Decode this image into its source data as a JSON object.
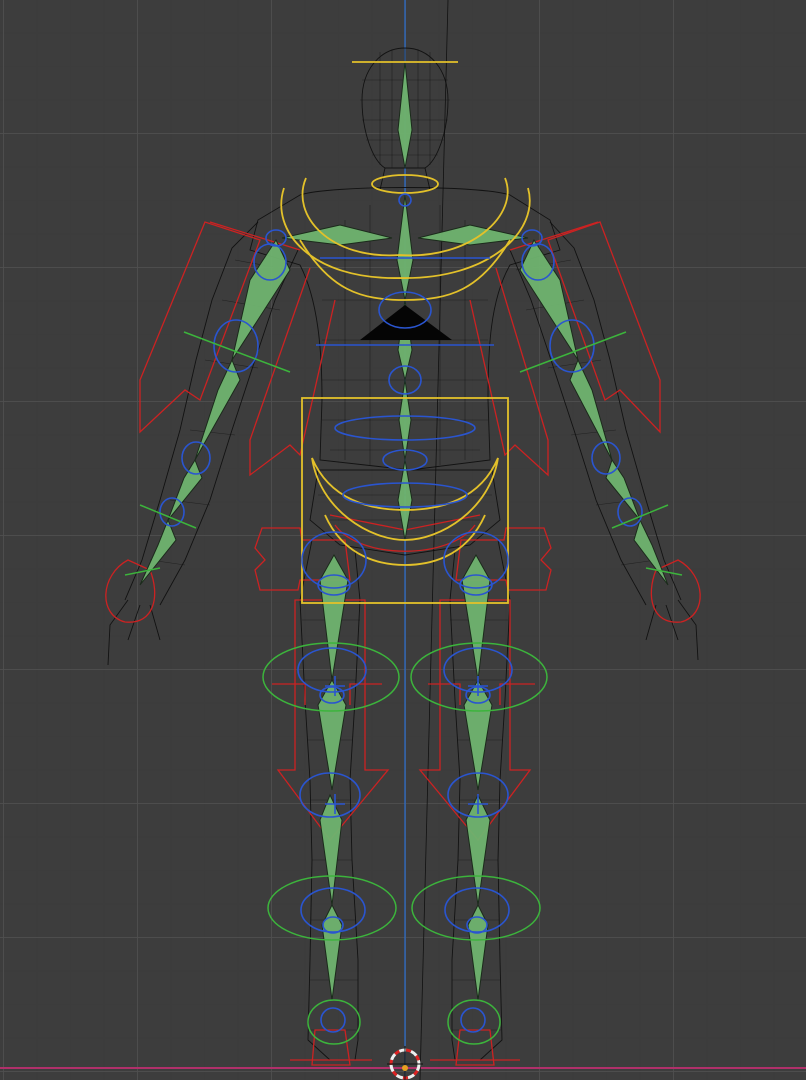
{
  "viewport": {
    "name": "3D Viewport",
    "mode": "wireframe",
    "view": "front-orthographic"
  },
  "scene": {
    "object": "character-rig",
    "colors": {
      "background": "#3d3d3d",
      "grid": "#505050",
      "bone": "#6fb46f",
      "ik_control": "#cc2222",
      "fk_control": "#2a55d0",
      "torso_control": "#e3c12a",
      "tweak_control": "#3cb43c",
      "z_axis": "#2a6fd0",
      "x_axis": "#b0306a"
    },
    "icons": {
      "cursor": "3d-cursor-icon"
    }
  }
}
